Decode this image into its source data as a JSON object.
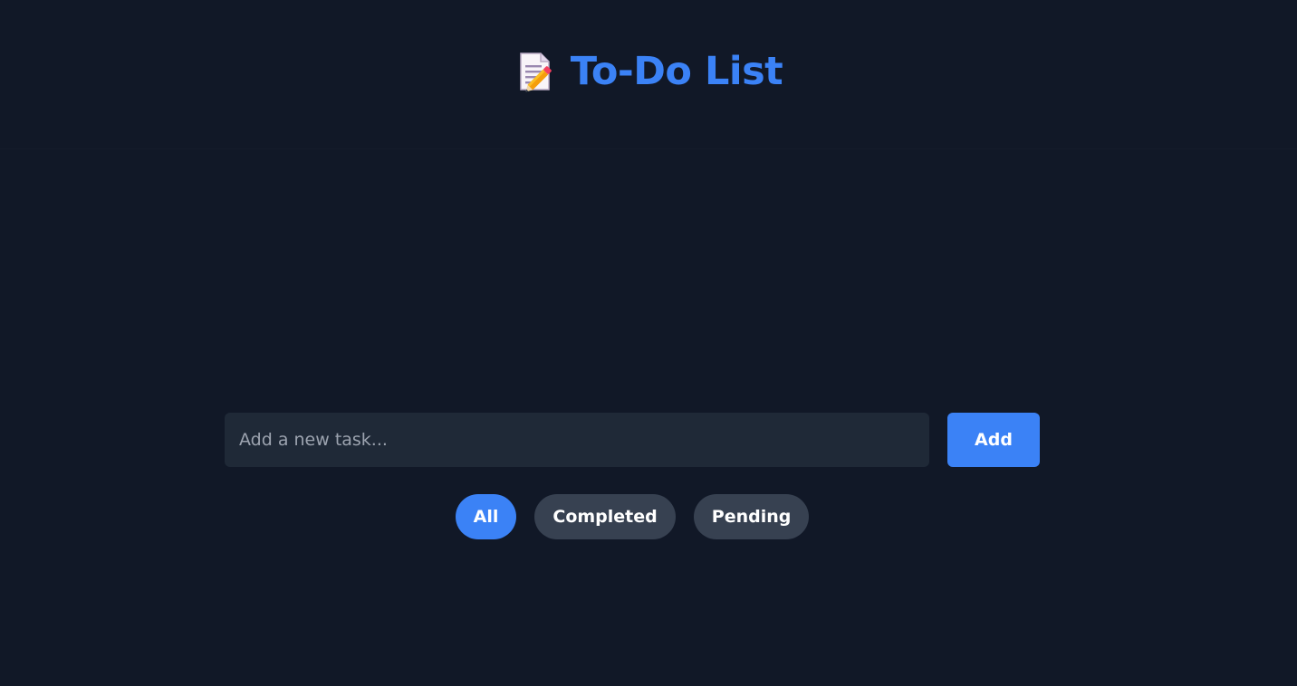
{
  "header": {
    "icon": "memo-icon",
    "title": "To-Do List"
  },
  "task_input": {
    "placeholder": "Add a new task...",
    "value": ""
  },
  "add_button": {
    "label": "Add"
  },
  "filters": [
    {
      "label": "All",
      "active": true
    },
    {
      "label": "Completed",
      "active": false
    },
    {
      "label": "Pending",
      "active": false
    }
  ],
  "colors": {
    "background": "#111827",
    "accent": "#3b82f6",
    "input_background": "#1f2937",
    "filter_background": "#374151"
  }
}
